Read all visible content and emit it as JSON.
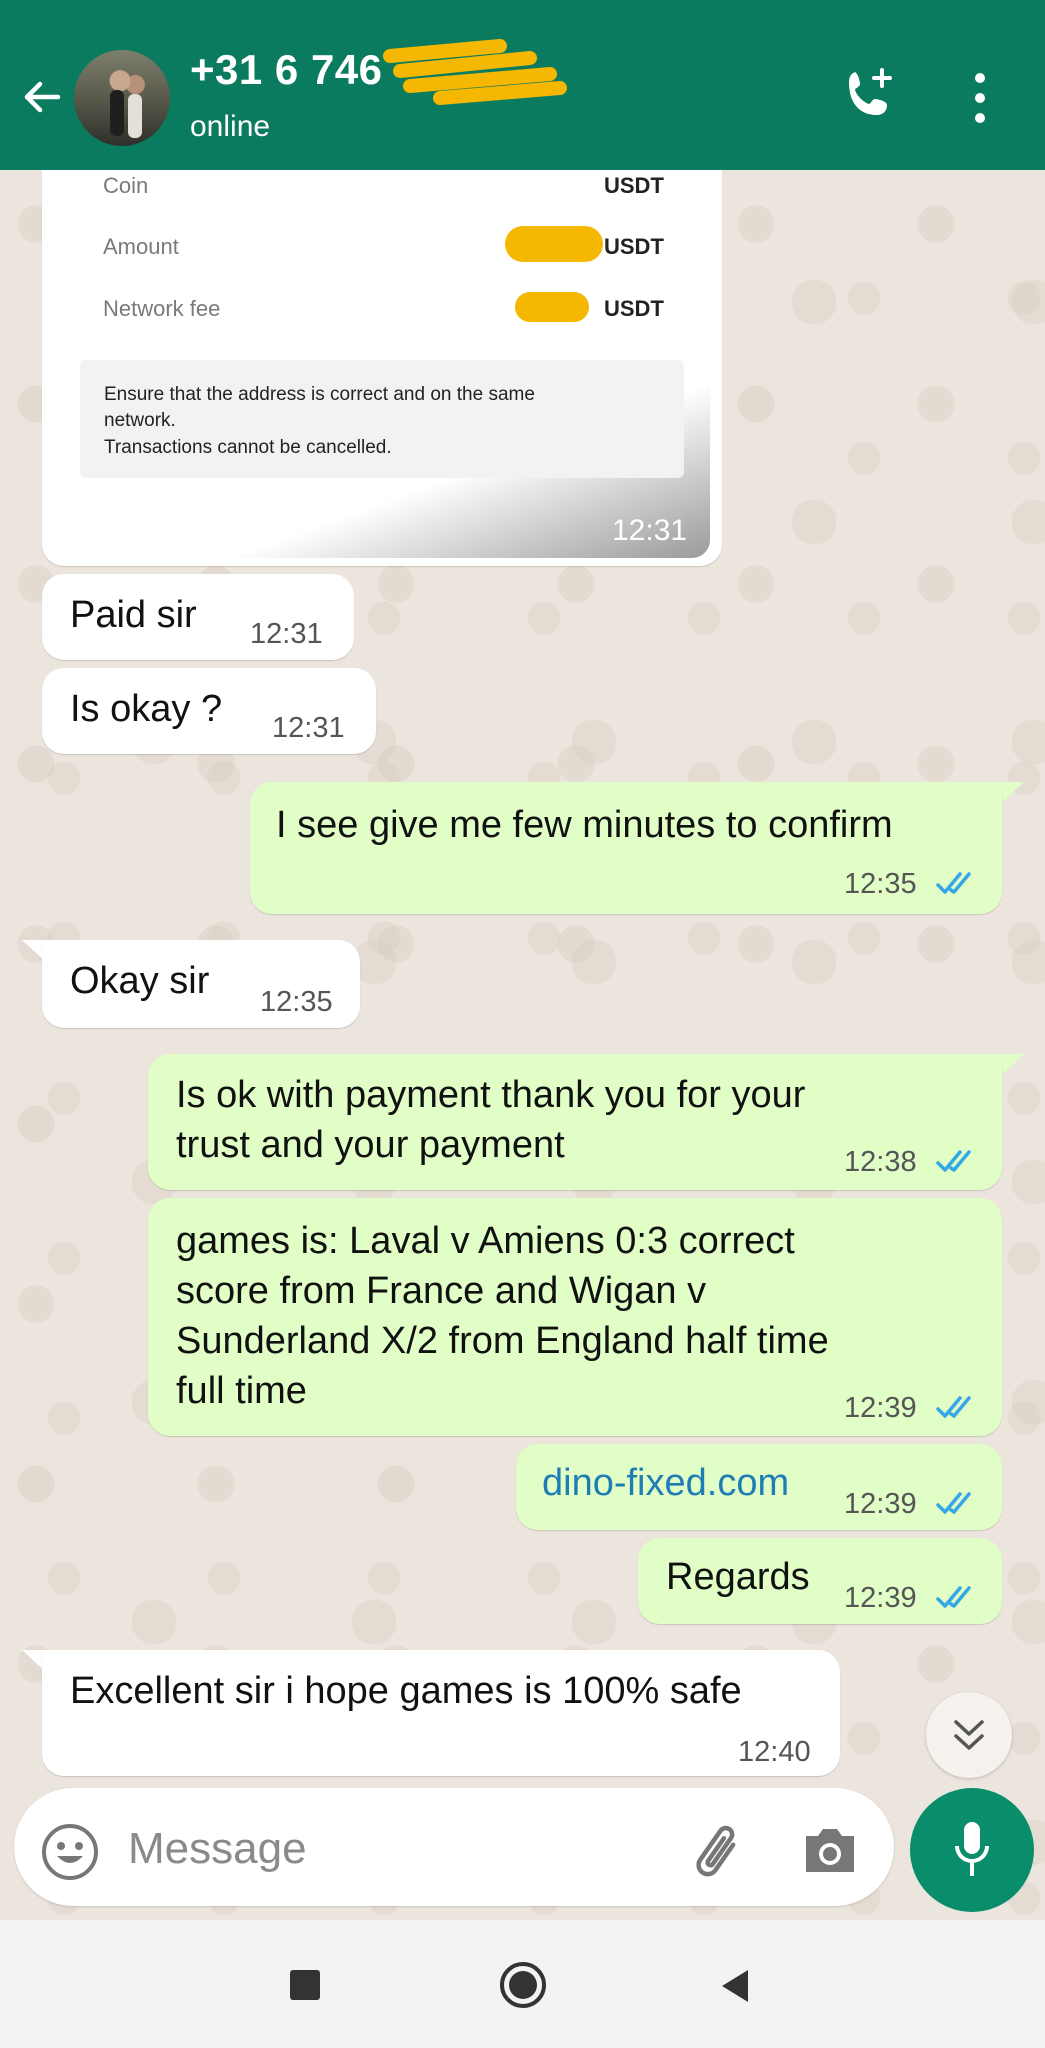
{
  "header": {
    "title": "+31 6 746",
    "subtitle": "online"
  },
  "screenshot": {
    "rows": [
      {
        "label": "Coin",
        "value": "USDT"
      },
      {
        "label": "Amount",
        "value": "USDT"
      },
      {
        "label": "Network fee",
        "value": "USDT"
      }
    ],
    "notice": [
      "Ensure that the address is correct and on the same",
      "network.",
      "Transactions cannot be cancelled."
    ],
    "time": "12:31"
  },
  "messages": [
    {
      "dir": "in",
      "text": "Paid sir",
      "time": "12:31"
    },
    {
      "dir": "in",
      "text": "Is okay ?",
      "time": "12:31"
    },
    {
      "dir": "out",
      "text": "I see give me few minutes to confirm",
      "time": "12:35"
    },
    {
      "dir": "in",
      "text": "Okay sir",
      "time": "12:35"
    },
    {
      "dir": "out",
      "lines": [
        "Is ok with payment thank you for your",
        "trust and your payment"
      ],
      "time": "12:38"
    },
    {
      "dir": "out",
      "lines": [
        "games is: Laval v Amiens 0:3 correct",
        "score from France and Wigan v",
        "Sunderland X/2 from England half time",
        "full time"
      ],
      "time": "12:39"
    },
    {
      "dir": "out",
      "text": "dino-fixed.com",
      "time": "12:39"
    },
    {
      "dir": "out",
      "text": "Regards",
      "time": "12:39"
    },
    {
      "dir": "in",
      "text": "Excellent sir i hope games is 100% safe",
      "time": "12:40"
    }
  ],
  "input": {
    "placeholder": "Message"
  },
  "colors": {
    "header": "#0a7b5f",
    "outgoing_bubble": "#e1fec6",
    "incoming_bubble": "#ffffff",
    "link": "#1e7db5",
    "read_ticks": "#34a7e6",
    "mic_button": "#0a8d6a",
    "redaction": "#f6b700"
  },
  "icons": [
    "back-arrow-icon",
    "add-call-icon",
    "more-vert-icon",
    "emoji-icon",
    "attach-icon",
    "camera-icon",
    "mic-icon",
    "chevron-down-double-icon",
    "nav-recents-icon",
    "nav-home-icon",
    "nav-back-icon"
  ]
}
